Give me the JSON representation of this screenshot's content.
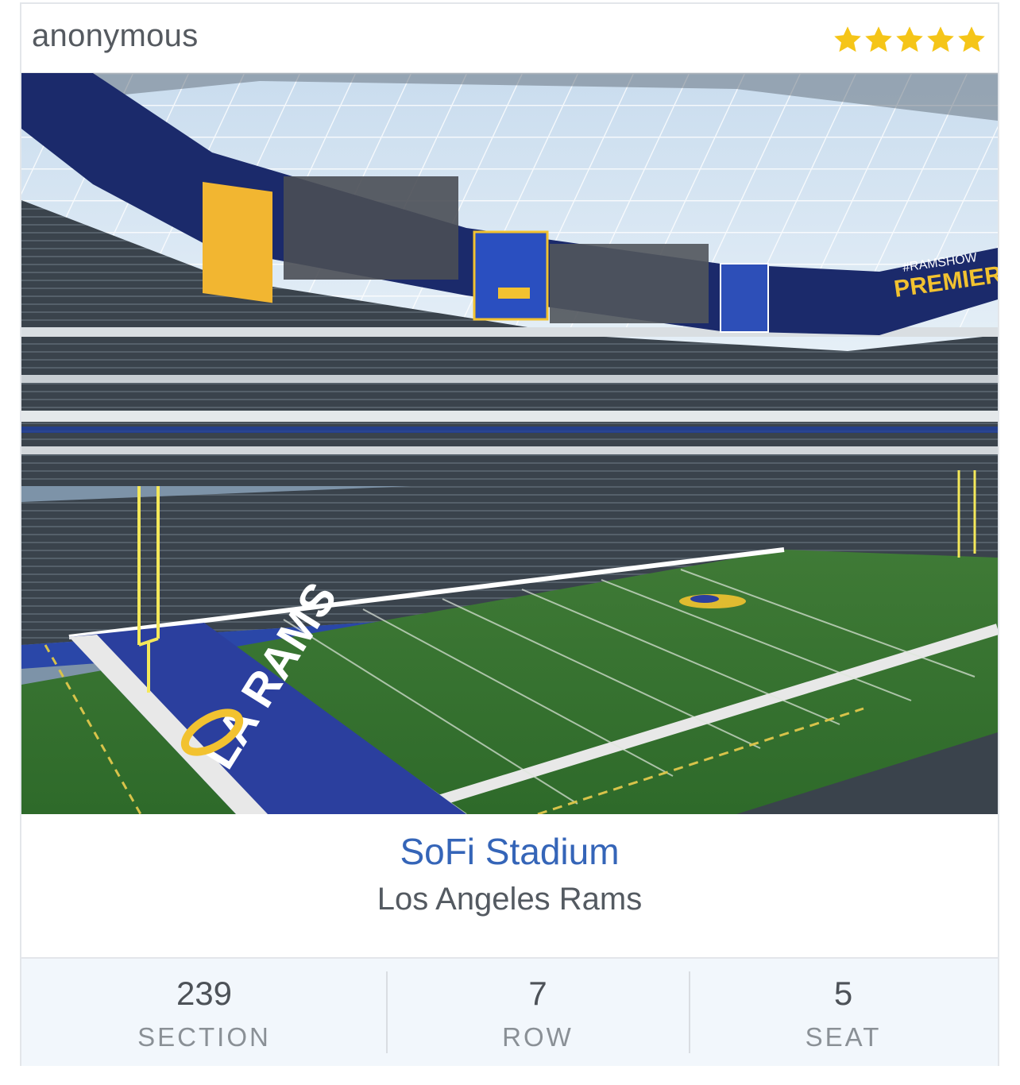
{
  "review": {
    "author": "anonymous",
    "rating": 5,
    "rating_max": 5,
    "star_color": "#f5c518",
    "star_icon": "star-icon"
  },
  "photo": {
    "alt": "View from seat of SoFi Stadium field",
    "scoreboard_text": "PREMIERE",
    "hashtag_text": "#RAMSHOW",
    "endzone_text": "LA RAMS"
  },
  "venue": {
    "name": "SoFi Stadium",
    "team": "Los Angeles Rams",
    "link_color": "#3565b8"
  },
  "seat_info": [
    {
      "value": "239",
      "label": "SECTION"
    },
    {
      "value": "7",
      "label": "ROW"
    },
    {
      "value": "5",
      "label": "SEAT"
    }
  ]
}
